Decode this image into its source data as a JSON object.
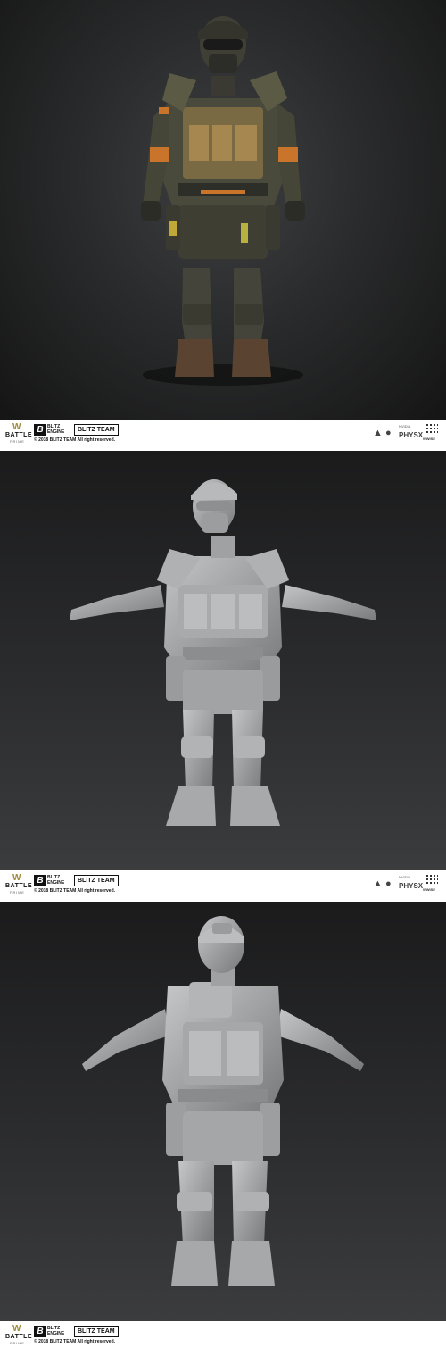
{
  "panels": [
    {
      "view": "textured-front"
    },
    {
      "view": "sculpt-front"
    },
    {
      "view": "sculpt-back"
    }
  ],
  "footer": {
    "battle_prime_line1": "BATTLE",
    "battle_prime_line2": "PRIME",
    "blitz_engine_line1": "BLITZ",
    "blitz_engine_line2": "ENGINE",
    "blitz_team": "BLITZ TEAM",
    "copyright": "© 2018 BLITZ TEAM  All right reserved.",
    "nvidia_label": "NVIDIA",
    "physx_label": "PHYSX",
    "wwise_label": "WWISE"
  },
  "colors": {
    "textured_bg": "#2a2b2c",
    "sculpt_bg": "#2b2c2e",
    "sculpt_clay": "#9a9b9c",
    "accent_orange": "#c8742a",
    "armor_olive": "#5b5a45"
  },
  "icons": [
    "android-icon",
    "apple-icon",
    "nvidia-icon",
    "wwise-icon"
  ]
}
